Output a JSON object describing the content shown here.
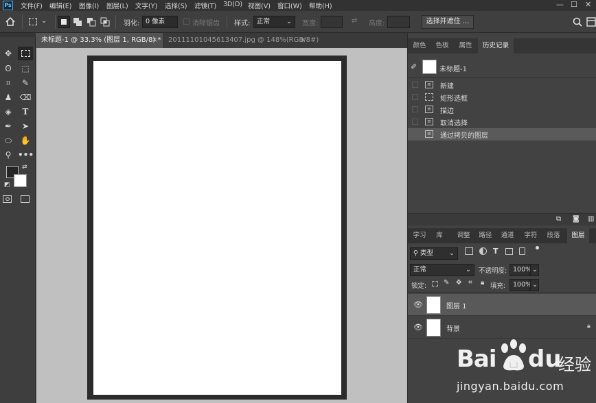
{
  "menubar": {
    "logo": "Ps",
    "items": [
      "文件(F)",
      "编辑(E)",
      "图像(I)",
      "图层(L)",
      "文字(Y)",
      "选择(S)",
      "滤镜(T)",
      "3D(D)",
      "视图(V)",
      "窗口(W)",
      "帮助(H)"
    ],
    "min": "—",
    "max": "☐",
    "close": "✕"
  },
  "options": {
    "feather_label": "羽化:",
    "feather_value": "0 像素",
    "antialias_label": "消除锯齿",
    "style_label": "样式:",
    "style_value": "正常",
    "width_label": "宽度:",
    "height_label": "高度:",
    "select_mask_button": "选择并遮住 ..."
  },
  "doc_tabs": [
    {
      "label": "未标题-1 @ 33.3% (图层 1, RGB/8) *",
      "close": "×",
      "active": true
    },
    {
      "label": "20111101045613407.jpg @ 148%(RGB/8#)",
      "close": "×",
      "active": false
    }
  ],
  "history_panel": {
    "tabs": [
      "颜色",
      "色板",
      "属性",
      "历史记录"
    ],
    "snapshot_label": "未标题-1",
    "items": [
      "新建",
      "矩形选框",
      "描边",
      "取消选择",
      "通过拷贝的图层"
    ]
  },
  "layers_panel": {
    "tabs": [
      "学习",
      "库",
      "调整",
      "路径",
      "通道",
      "字符",
      "段落",
      "图层"
    ],
    "filter_label": "类型",
    "blend_mode": "正常",
    "opacity_label": "不透明度:",
    "opacity_value": "100%",
    "lock_label": "锁定:",
    "fill_label": "填充:",
    "fill_value": "100%",
    "layers": [
      {
        "name": "图层 1",
        "selected": true,
        "locked": false
      },
      {
        "name": "背景",
        "selected": false,
        "locked": true
      }
    ]
  },
  "watermark": {
    "brand": "Bai",
    "brand2": "du",
    "cn": "经验",
    "url": "jingyan.baidu.com"
  }
}
